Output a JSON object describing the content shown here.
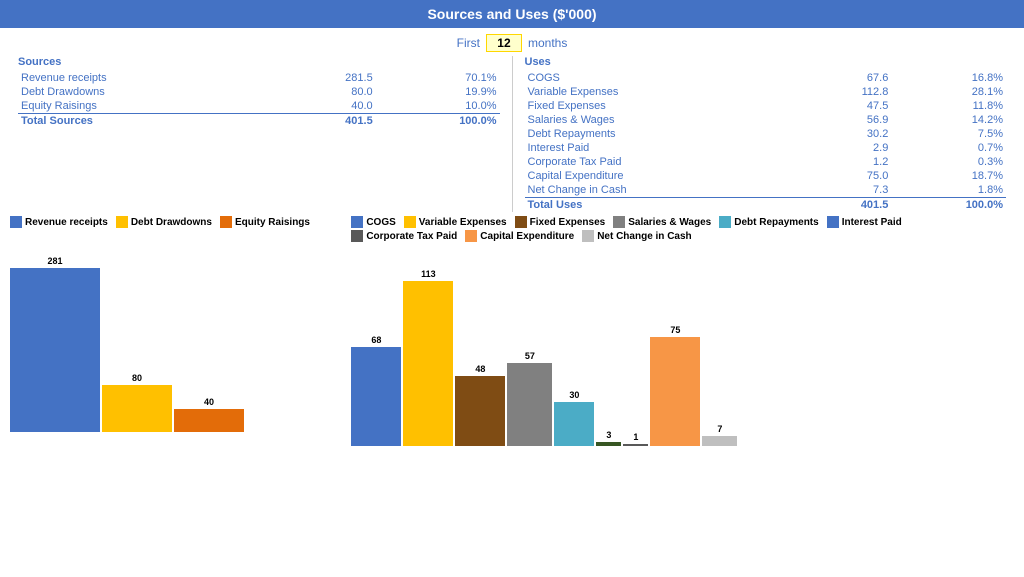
{
  "title": "Sources and Uses ($'000)",
  "months_label_before": "First",
  "months_value": "12",
  "months_label_after": "months",
  "sources": {
    "heading": "Sources",
    "rows": [
      {
        "label": "Revenue receipts",
        "value": "281.5",
        "percent": "70.1%"
      },
      {
        "label": "Debt Drawdowns",
        "value": "80.0",
        "percent": "19.9%"
      },
      {
        "label": "Equity Raisings",
        "value": "40.0",
        "percent": "10.0%"
      }
    ],
    "total_label": "Total Sources",
    "total_value": "401.5",
    "total_percent": "100.0%"
  },
  "uses": {
    "heading": "Uses",
    "rows": [
      {
        "label": "COGS",
        "value": "67.6",
        "percent": "16.8%"
      },
      {
        "label": "Variable Expenses",
        "value": "112.8",
        "percent": "28.1%"
      },
      {
        "label": "Fixed Expenses",
        "value": "47.5",
        "percent": "11.8%"
      },
      {
        "label": "Salaries & Wages",
        "value": "56.9",
        "percent": "14.2%"
      },
      {
        "label": "Debt Repayments",
        "value": "30.2",
        "percent": "7.5%"
      },
      {
        "label": "Interest Paid",
        "value": "2.9",
        "percent": "0.7%"
      },
      {
        "label": "Corporate Tax Paid",
        "value": "1.2",
        "percent": "0.3%"
      },
      {
        "label": "Capital Expenditure",
        "value": "75.0",
        "percent": "18.7%"
      },
      {
        "label": "Net Change in Cash",
        "value": "7.3",
        "percent": "1.8%"
      }
    ],
    "total_label": "Total Uses",
    "total_value": "401.5",
    "total_percent": "100.0%"
  },
  "sources_chart": {
    "legend": [
      {
        "label": "Revenue receipts",
        "color": "#4472C4"
      },
      {
        "label": "Debt Drawdowns",
        "color": "#FFC000"
      },
      {
        "label": "Equity Raisings",
        "color": "#E36C09"
      }
    ],
    "bars": [
      {
        "label": "281",
        "value": 281,
        "color": "#4472C4"
      },
      {
        "label": "80",
        "value": 80,
        "color": "#FFC000"
      },
      {
        "label": "40",
        "value": 40,
        "color": "#E36C09"
      }
    ],
    "max_value": 300
  },
  "uses_chart": {
    "legend": [
      {
        "label": "COGS",
        "color": "#4472C4"
      },
      {
        "label": "Variable Expenses",
        "color": "#FFC000"
      },
      {
        "label": "Fixed Expenses",
        "color": "#7F4C14"
      },
      {
        "label": "Salaries & Wages",
        "color": "#808080"
      },
      {
        "label": "Debt Repayments",
        "color": "#4BACC6"
      },
      {
        "label": "Interest Paid",
        "color": "#4472C4"
      },
      {
        "label": "Corporate Tax Paid",
        "color": "#808080"
      },
      {
        "label": "Capital Expenditure",
        "color": "#F79646"
      },
      {
        "label": "Net Change in Cash",
        "color": "#BFBFBF"
      }
    ],
    "bars": [
      {
        "label": "68",
        "value": 68,
        "color": "#4472C4"
      },
      {
        "label": "113",
        "value": 113,
        "color": "#FFC000"
      },
      {
        "label": "48",
        "value": 48,
        "color": "#7F4C14"
      },
      {
        "label": "57",
        "value": 57,
        "color": "#808080"
      },
      {
        "label": "30",
        "value": 30,
        "color": "#4BACC6"
      },
      {
        "label": "3",
        "value": 3,
        "color": "#375623"
      },
      {
        "label": "1",
        "value": 1,
        "color": "#595959"
      },
      {
        "label": "75",
        "value": 75,
        "color": "#F79646"
      },
      {
        "label": "7",
        "value": 7,
        "color": "#BFBFBF"
      }
    ],
    "max_value": 120
  }
}
